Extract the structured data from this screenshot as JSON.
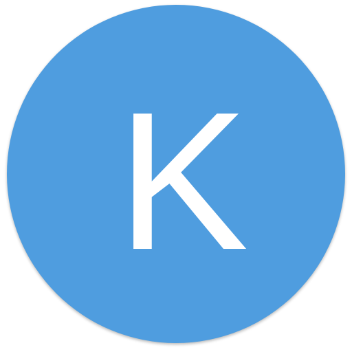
{
  "avatar": {
    "initial": "K",
    "background_color": "#4f9ddf",
    "text_color": "#ffffff",
    "shape": "circle"
  }
}
